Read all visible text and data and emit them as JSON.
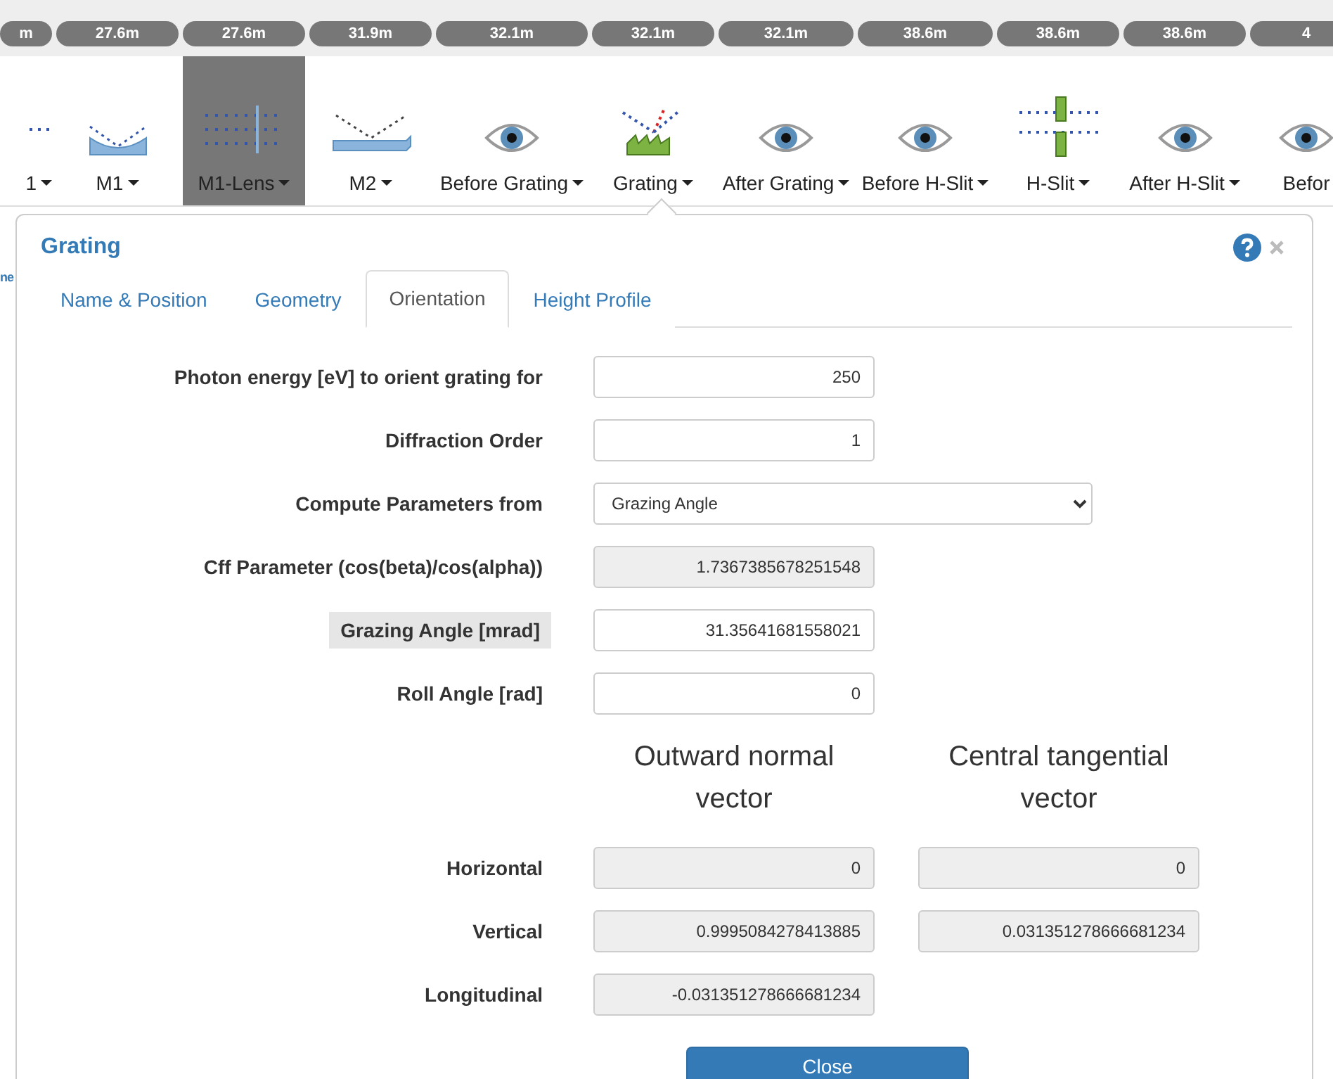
{
  "beamline": [
    {
      "distance": "m",
      "label": "1",
      "kind": "beam",
      "selected": false
    },
    {
      "distance": "27.6m",
      "label": "M1",
      "kind": "curved",
      "selected": false
    },
    {
      "distance": "27.6m",
      "label": "M1-Lens",
      "kind": "lens",
      "selected": true
    },
    {
      "distance": "31.9m",
      "label": "M2",
      "kind": "mirror",
      "selected": false
    },
    {
      "distance": "32.1m",
      "label": "Before Grating",
      "kind": "monitor",
      "selected": false
    },
    {
      "distance": "32.1m",
      "label": "Grating",
      "kind": "grating",
      "selected": false
    },
    {
      "distance": "32.1m",
      "label": "After Grating",
      "kind": "monitor",
      "selected": false
    },
    {
      "distance": "38.6m",
      "label": "Before H-Slit",
      "kind": "monitor",
      "selected": false
    },
    {
      "distance": "38.6m",
      "label": "H-Slit",
      "kind": "slit",
      "selected": false
    },
    {
      "distance": "38.6m",
      "label": "After H-Slit",
      "kind": "monitor",
      "selected": false
    },
    {
      "distance": "4",
      "label": "Befor",
      "kind": "monitor",
      "selected": false
    }
  ],
  "background_text": "ne",
  "dialog": {
    "title": "Grating",
    "tabs": [
      {
        "label": "Name & Position",
        "selected": false
      },
      {
        "label": "Geometry",
        "selected": false
      },
      {
        "label": "Orientation",
        "selected": true
      },
      {
        "label": "Height Profile",
        "selected": false
      }
    ],
    "fields": [
      {
        "kind": "input",
        "label": "Photon energy [eV] to orient grating for",
        "value": "250",
        "highlighted": false
      },
      {
        "kind": "input",
        "label": "Diffraction Order",
        "value": "1",
        "highlighted": false
      },
      {
        "kind": "select",
        "label": "Compute Parameters from",
        "value": "Grazing Angle",
        "highlighted": false
      },
      {
        "kind": "readonly",
        "label": "Cff Parameter (cos(beta)/cos(alpha))",
        "value": "1.7367385678251548",
        "highlighted": false
      },
      {
        "kind": "input",
        "label": "Grazing Angle [mrad]",
        "value": "31.35641681558021",
        "highlighted": true
      },
      {
        "kind": "input",
        "label": "Roll Angle [rad]",
        "value": "0",
        "highlighted": false
      }
    ],
    "vector_headers": [
      "Outward normal vector",
      "Central tangential vector"
    ],
    "vector_rows": [
      {
        "label": "Horizontal",
        "values": [
          "0",
          "0"
        ]
      },
      {
        "label": "Vertical",
        "values": [
          "0.9995084278413885",
          "0.031351278666681234"
        ]
      },
      {
        "label": "Longitudinal",
        "values": [
          "-0.031351278666681234"
        ]
      }
    ],
    "close_button": "Close"
  }
}
